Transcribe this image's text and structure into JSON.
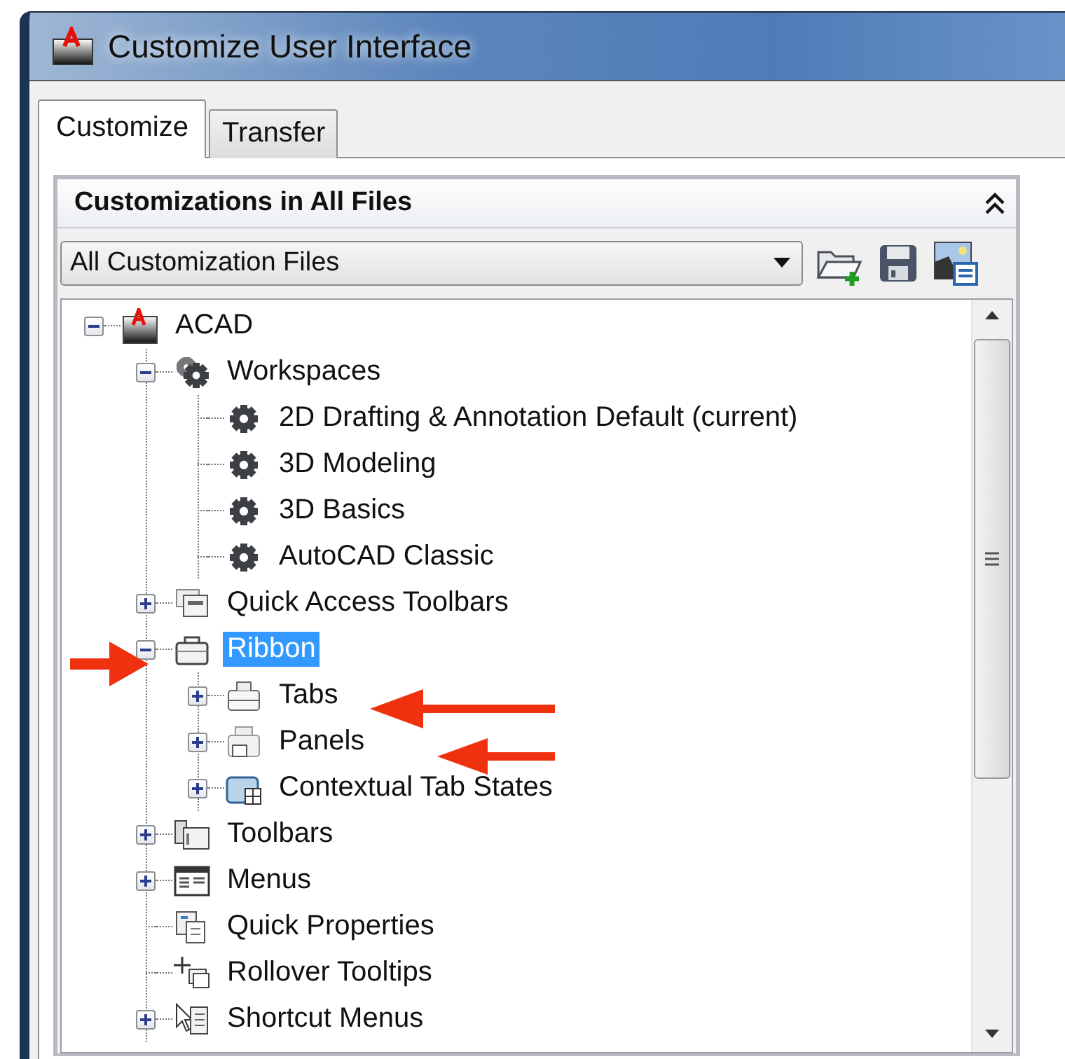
{
  "window": {
    "title": "Customize User Interface"
  },
  "tabs": [
    {
      "label": "Customize",
      "selected": true
    },
    {
      "label": "Transfer",
      "selected": false
    }
  ],
  "panel": {
    "title": "Customizations in All Files"
  },
  "file_filter": {
    "value": "All Customization Files"
  },
  "tree": [
    {
      "label": "ACAD",
      "kind": "acad",
      "expanded": true,
      "selected": false,
      "children": [
        {
          "label": "Workspaces",
          "kind": "gears",
          "expanded": true,
          "selected": false,
          "children": [
            {
              "label": "2D Drafting & Annotation Default (current)",
              "kind": "gear",
              "selected": false
            },
            {
              "label": "3D Modeling",
              "kind": "gear",
              "selected": false
            },
            {
              "label": "3D Basics",
              "kind": "gear",
              "selected": false
            },
            {
              "label": "AutoCAD Classic",
              "kind": "gear",
              "selected": false
            }
          ]
        },
        {
          "label": "Quick Access Toolbars",
          "kind": "toolbar",
          "expanded": false,
          "selected": false
        },
        {
          "label": "Ribbon",
          "kind": "case",
          "expanded": true,
          "selected": true,
          "children": [
            {
              "label": "Tabs",
              "kind": "tabs",
              "expanded": false,
              "selected": false
            },
            {
              "label": "Panels",
              "kind": "panels",
              "expanded": false,
              "selected": false
            },
            {
              "label": "Contextual Tab States",
              "kind": "contextual",
              "expanded": false,
              "selected": false
            }
          ]
        },
        {
          "label": "Toolbars",
          "kind": "toolbars",
          "expanded": false,
          "selected": false
        },
        {
          "label": "Menus",
          "kind": "menus",
          "expanded": false,
          "selected": false
        },
        {
          "label": "Quick Properties",
          "kind": "properties",
          "selected": false
        },
        {
          "label": "Rollover Tooltips",
          "kind": "tooltips",
          "selected": false
        },
        {
          "label": "Shortcut Menus",
          "kind": "shortcut",
          "expanded": false,
          "selected": false
        }
      ]
    }
  ]
}
